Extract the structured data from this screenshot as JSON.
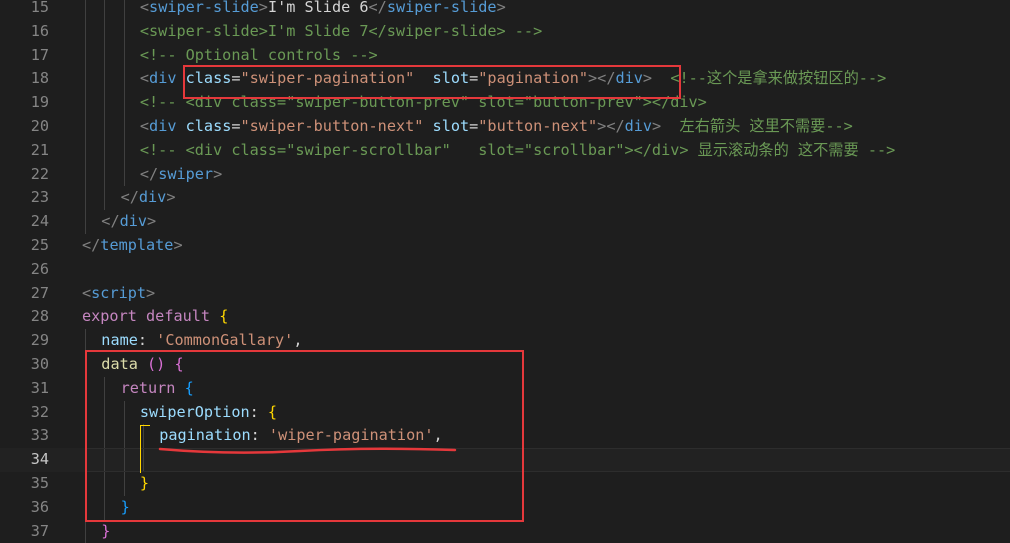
{
  "editor": {
    "active_line": 34,
    "lines": [
      {
        "n": 15,
        "indent": 3,
        "tokens": [
          [
            "t-punc",
            "<"
          ],
          [
            "t-tag",
            "swiper-slide"
          ],
          [
            "t-punc",
            ">"
          ],
          [
            "t-def",
            "I'm Slide 6"
          ],
          [
            "t-punc",
            "</"
          ],
          [
            "t-tag",
            "swiper-slide"
          ],
          [
            "t-punc",
            ">"
          ]
        ]
      },
      {
        "n": 16,
        "indent": 3,
        "tokens": [
          [
            "t-cm",
            "<swiper-slide>I'm Slide 7</swiper-slide> -->"
          ]
        ]
      },
      {
        "n": 17,
        "indent": 3,
        "tokens": [
          [
            "t-cm",
            "<!-- Optional controls -->"
          ]
        ]
      },
      {
        "n": 18,
        "indent": 3,
        "tokens": [
          [
            "t-punc",
            "<"
          ],
          [
            "t-tag",
            "div"
          ],
          [
            "t-def",
            " "
          ],
          [
            "t-attr",
            "class"
          ],
          [
            "t-def",
            "="
          ],
          [
            "t-str",
            "\"swiper-pagination\""
          ],
          [
            "t-def",
            "  "
          ],
          [
            "t-attr",
            "slot"
          ],
          [
            "t-def",
            "="
          ],
          [
            "t-str",
            "\"pagination\""
          ],
          [
            "t-punc",
            ">"
          ],
          [
            "t-punc",
            "</"
          ],
          [
            "t-tag",
            "div"
          ],
          [
            "t-punc",
            ">"
          ],
          [
            "t-def",
            "  "
          ],
          [
            "t-cm",
            "<!--这个是拿来做按钮区的-->"
          ]
        ]
      },
      {
        "n": 19,
        "indent": 3,
        "tokens": [
          [
            "t-cm",
            "<!-- <div class=\"swiper-button-prev\" slot=\"button-prev\"></div>"
          ]
        ]
      },
      {
        "n": 20,
        "indent": 3,
        "tokens": [
          [
            "t-punc",
            "<"
          ],
          [
            "t-tag",
            "div"
          ],
          [
            "t-def",
            " "
          ],
          [
            "t-attr",
            "class"
          ],
          [
            "t-def",
            "="
          ],
          [
            "t-str",
            "\"swiper-button-next\""
          ],
          [
            "t-def",
            " "
          ],
          [
            "t-attr",
            "slot"
          ],
          [
            "t-def",
            "="
          ],
          [
            "t-str",
            "\"button-next\""
          ],
          [
            "t-punc",
            ">"
          ],
          [
            "t-punc",
            "</"
          ],
          [
            "t-tag",
            "div"
          ],
          [
            "t-punc",
            ">"
          ],
          [
            "t-def",
            "  "
          ],
          [
            "t-cm",
            "左右箭头 这里不需要-->"
          ]
        ]
      },
      {
        "n": 21,
        "indent": 3,
        "tokens": [
          [
            "t-cm",
            "<!-- <div class=\"swiper-scrollbar\"   slot=\"scrollbar\"></div> 显示滚动条的 这不需要 -->"
          ]
        ]
      },
      {
        "n": 22,
        "indent": 3,
        "tokens": [
          [
            "t-punc",
            "</"
          ],
          [
            "t-tag",
            "swiper"
          ],
          [
            "t-punc",
            ">"
          ]
        ]
      },
      {
        "n": 23,
        "indent": 2,
        "tokens": [
          [
            "t-punc",
            "</"
          ],
          [
            "t-tag",
            "div"
          ],
          [
            "t-punc",
            ">"
          ]
        ]
      },
      {
        "n": 24,
        "indent": 1,
        "tokens": [
          [
            "t-punc",
            "</"
          ],
          [
            "t-tag",
            "div"
          ],
          [
            "t-punc",
            ">"
          ]
        ]
      },
      {
        "n": 25,
        "indent": 0,
        "tokens": [
          [
            "t-punc",
            "</"
          ],
          [
            "t-tag",
            "template"
          ],
          [
            "t-punc",
            ">"
          ]
        ]
      },
      {
        "n": 26,
        "indent": 0,
        "tokens": []
      },
      {
        "n": 27,
        "indent": 0,
        "tokens": [
          [
            "t-punc",
            "<"
          ],
          [
            "t-tag",
            "script"
          ],
          [
            "t-punc",
            ">"
          ]
        ]
      },
      {
        "n": 28,
        "indent": 0,
        "tokens": [
          [
            "t-kw",
            "export"
          ],
          [
            "t-def",
            " "
          ],
          [
            "t-kw",
            "default"
          ],
          [
            "t-def",
            " "
          ],
          [
            "t-br1",
            "{"
          ]
        ]
      },
      {
        "n": 29,
        "indent": 1,
        "tokens": [
          [
            "t-var",
            "name"
          ],
          [
            "t-def",
            ": "
          ],
          [
            "t-str",
            "'CommonGallary'"
          ],
          [
            "t-def",
            ","
          ]
        ]
      },
      {
        "n": 30,
        "indent": 1,
        "tokens": [
          [
            "t-fn",
            "data"
          ],
          [
            "t-def",
            " "
          ],
          [
            "t-br2",
            "()"
          ],
          [
            "t-def",
            " "
          ],
          [
            "t-br2",
            "{"
          ]
        ]
      },
      {
        "n": 31,
        "indent": 2,
        "tokens": [
          [
            "t-kw",
            "return"
          ],
          [
            "t-def",
            " "
          ],
          [
            "t-br3",
            "{"
          ]
        ]
      },
      {
        "n": 32,
        "indent": 3,
        "tokens": [
          [
            "t-var",
            "swiperOption"
          ],
          [
            "t-def",
            ": "
          ],
          [
            "t-br1",
            "{"
          ]
        ]
      },
      {
        "n": 33,
        "indent": 4,
        "tokens": [
          [
            "t-var",
            "pagination"
          ],
          [
            "t-def",
            ": "
          ],
          [
            "t-str",
            "'wiper-pagination'"
          ],
          [
            "t-def",
            ","
          ]
        ]
      },
      {
        "n": 34,
        "indent": 4,
        "tokens": []
      },
      {
        "n": 35,
        "indent": 3,
        "tokens": [
          [
            "t-br1",
            "}"
          ]
        ]
      },
      {
        "n": 36,
        "indent": 2,
        "tokens": [
          [
            "t-br3",
            "}"
          ]
        ]
      },
      {
        "n": 37,
        "indent": 1,
        "tokens": [
          [
            "t-br2",
            "}"
          ]
        ]
      }
    ]
  },
  "colors": {
    "background": "#1e1e1e",
    "annotation_red": "#e5383b",
    "bracket_guide": "#ffd700"
  }
}
